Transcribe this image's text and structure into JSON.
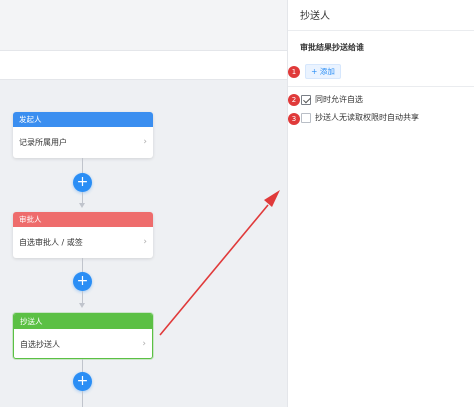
{
  "canvas": {
    "nodes": [
      {
        "title": "发起人",
        "content": "记录所属用户",
        "header_color": "#3a8ef0"
      },
      {
        "title": "审批人",
        "content": "自选审批人 / 或签",
        "header_color": "#ee6c6c"
      },
      {
        "title": "抄送人",
        "content": "自选抄送人",
        "header_color": "#5bc044"
      }
    ],
    "add_symbol": "+",
    "chevron": "›"
  },
  "panel": {
    "title": "抄送人",
    "section_label": "审批结果抄送给谁",
    "add_button": "+ 添加",
    "options": [
      {
        "label": "同时允许自选",
        "checked": true
      },
      {
        "label": "抄送人无读取权限时自动共享",
        "checked": false
      }
    ]
  },
  "annotations": {
    "badges": [
      "1",
      "2",
      "3"
    ],
    "arrow_color": "#e03a3a"
  },
  "colors": {
    "accent": "#2a8ef5",
    "selected_border": "#5bc044"
  }
}
